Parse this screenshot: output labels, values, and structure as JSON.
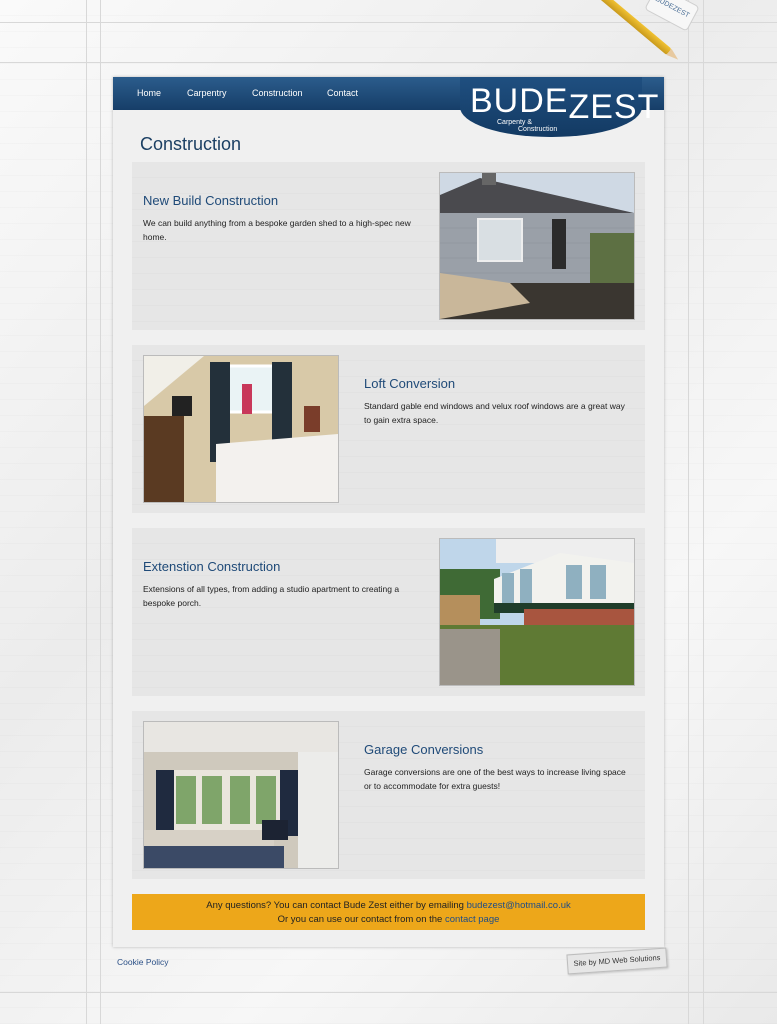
{
  "nav": {
    "items": [
      "Home",
      "Carpentry",
      "Construction",
      "Contact"
    ]
  },
  "logo": {
    "word_part1": "BUDE",
    "word_part2": "ZEST",
    "tag_line1": "Carpenty &",
    "tag_line2": "Construction",
    "eraser_text": "BUDEZEST"
  },
  "page": {
    "title": "Construction"
  },
  "sections": [
    {
      "title": "New Build Construction",
      "text": "We can build anything from a bespoke garden shed to a high-spec new home.",
      "image_subject": "new-build-extension"
    },
    {
      "title": "Loft Conversion",
      "text": "Standard gable end windows and velux roof windows are a great way to gain extra space.",
      "image_subject": "loft-bedroom"
    },
    {
      "title": "Extenstion Construction",
      "text": "Extensions of all types, from adding a studio apartment to creating a bespoke porch.",
      "image_subject": "conservatory-porch"
    },
    {
      "title": "Garage Conversions",
      "text": "Garage conversions are one of the best ways to increase living space or to accommodate for extra guests!",
      "image_subject": "converted-garage-bedroom"
    }
  ],
  "footer": {
    "line1_prefix": "Any questions? You can contact Bude Zest either by emailing ",
    "email": "budezest@hotmail.co.uk",
    "line2_prefix": "Or you can use our contact from on the ",
    "contact_link": "contact page",
    "cookie_policy": "Cookie Policy",
    "credit": "Site by MD Web Solutions"
  },
  "colors": {
    "navbar": "#163e68",
    "title_blue": "#1b3f63",
    "footer_bar": "#eda71a"
  }
}
